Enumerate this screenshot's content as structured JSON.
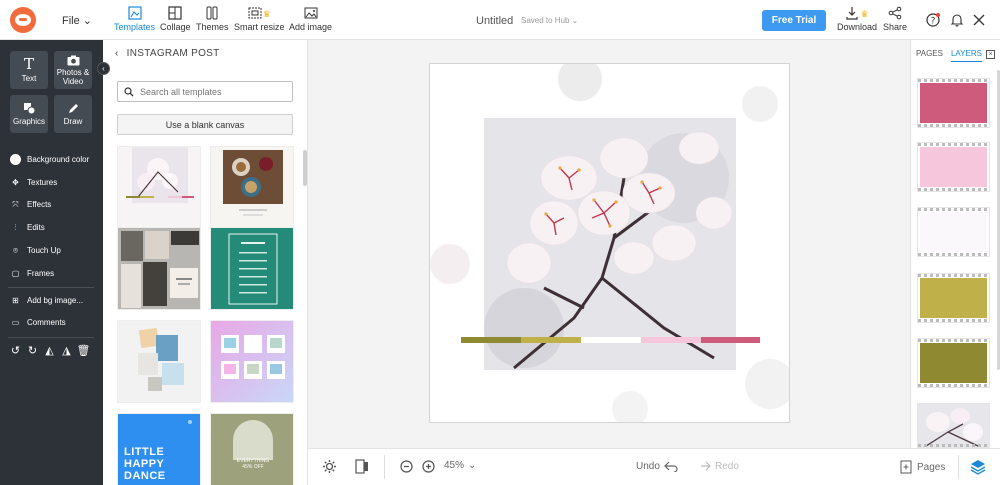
{
  "topbar": {
    "file_label": "File",
    "tools": [
      {
        "label": "Templates",
        "icon": "templates-icon"
      },
      {
        "label": "Collage",
        "icon": "collage-icon"
      },
      {
        "label": "Themes",
        "icon": "themes-icon"
      },
      {
        "label": "Smart resize",
        "icon": "smart-resize-icon"
      },
      {
        "label": "Add image",
        "icon": "add-image-icon"
      }
    ],
    "doc_title": "Untitled",
    "saved_status": "Saved to Hub",
    "free_trial_label": "Free Trial",
    "download_label": "Download",
    "share_label": "Share"
  },
  "rail": {
    "tiles": [
      {
        "label": "Text",
        "glyph": "T"
      },
      {
        "label": "Photos & Video",
        "glyph": "📷"
      },
      {
        "label": "Graphics",
        "glyph": "◆"
      },
      {
        "label": "Draw",
        "glyph": "✎"
      }
    ],
    "items": [
      {
        "label": "Background color"
      },
      {
        "label": "Textures"
      },
      {
        "label": "Effects"
      },
      {
        "label": "Edits"
      },
      {
        "label": "Touch Up"
      },
      {
        "label": "Frames"
      },
      {
        "label": "Add bg image..."
      },
      {
        "label": "Comments"
      }
    ]
  },
  "templates_panel": {
    "header": "INSTAGRAM POST",
    "search_placeholder": "Search all templates",
    "blank_canvas_label": "Use a blank canvas",
    "thumb_texts": {
      "thumb4": "LITTLE HAPPY DANCE",
      "thumb8": "EVERYTHING 45% OFF"
    }
  },
  "canvas": {
    "zoom": "45%",
    "undo_label": "Undo",
    "redo_label": "Redo",
    "pages_label": "Pages",
    "stripe_colors": [
      "#8f8a32",
      "#c0b04a",
      "#ffffff",
      "#f6c6dd",
      "#cf5b7c"
    ]
  },
  "right_panel": {
    "tabs": [
      "PAGES",
      "LAYERS"
    ],
    "active_tab": "LAYERS",
    "layer_colors": [
      "#cf5b7c",
      "#f6c6dd",
      "#faf8fa",
      "#c0b04a",
      "#8f8a32"
    ],
    "accent_color": "#1a8ad8"
  }
}
